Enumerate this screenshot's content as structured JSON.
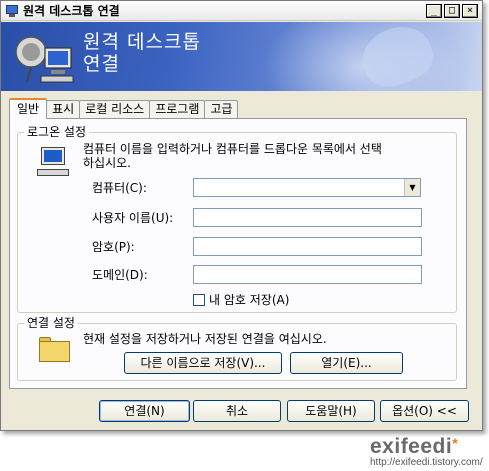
{
  "window": {
    "title": "원격 데스크톱 연결",
    "controls": [
      "_",
      "□",
      "×"
    ]
  },
  "banner": {
    "title_line1": "원격 데스크톱",
    "title_line2": "연결"
  },
  "tabs": [
    "일반",
    "표시",
    "로컬 리소스",
    "프로그램",
    "고급"
  ],
  "login": {
    "group_label": "로그온 설정",
    "instruction": "컴퓨터 이름을 입력하거나 컴퓨터를 드롭다운 목록에서 선택하십시오.",
    "instruction_line1": "컴퓨터 이름을 입력하거나 컴퓨터를 드롭다운 목록에서 선택",
    "instruction_line2": "하십시오.",
    "computer_label": "컴퓨터(C):",
    "computer_value": "",
    "username_label": "사용자 이름(U):",
    "username_value": "",
    "password_label": "암호(P):",
    "password_value": "",
    "domain_label": "도메인(D):",
    "domain_value": "",
    "save_password_label": "내 암호 저장(A)",
    "save_password_checked": false
  },
  "connection": {
    "group_label": "연결 설정",
    "description": "현재 설정을 저장하거나 저장된 연결을 여십시오.",
    "save_as_label": "다른 이름으로 저장(V)...",
    "open_label": "열기(E)..."
  },
  "footer": {
    "connect_label": "연결(N)",
    "cancel_label": "취소",
    "help_label": "도움말(H)",
    "options_label": "옵션(O) <<"
  },
  "watermark": {
    "logo": "exifeedi",
    "url": "http://exifeedi.tistory.com/"
  },
  "icons": [
    "window-icon",
    "remote-desktop-banner-icon",
    "computer-icon",
    "folder-icon",
    "combo-arrow-icon"
  ]
}
